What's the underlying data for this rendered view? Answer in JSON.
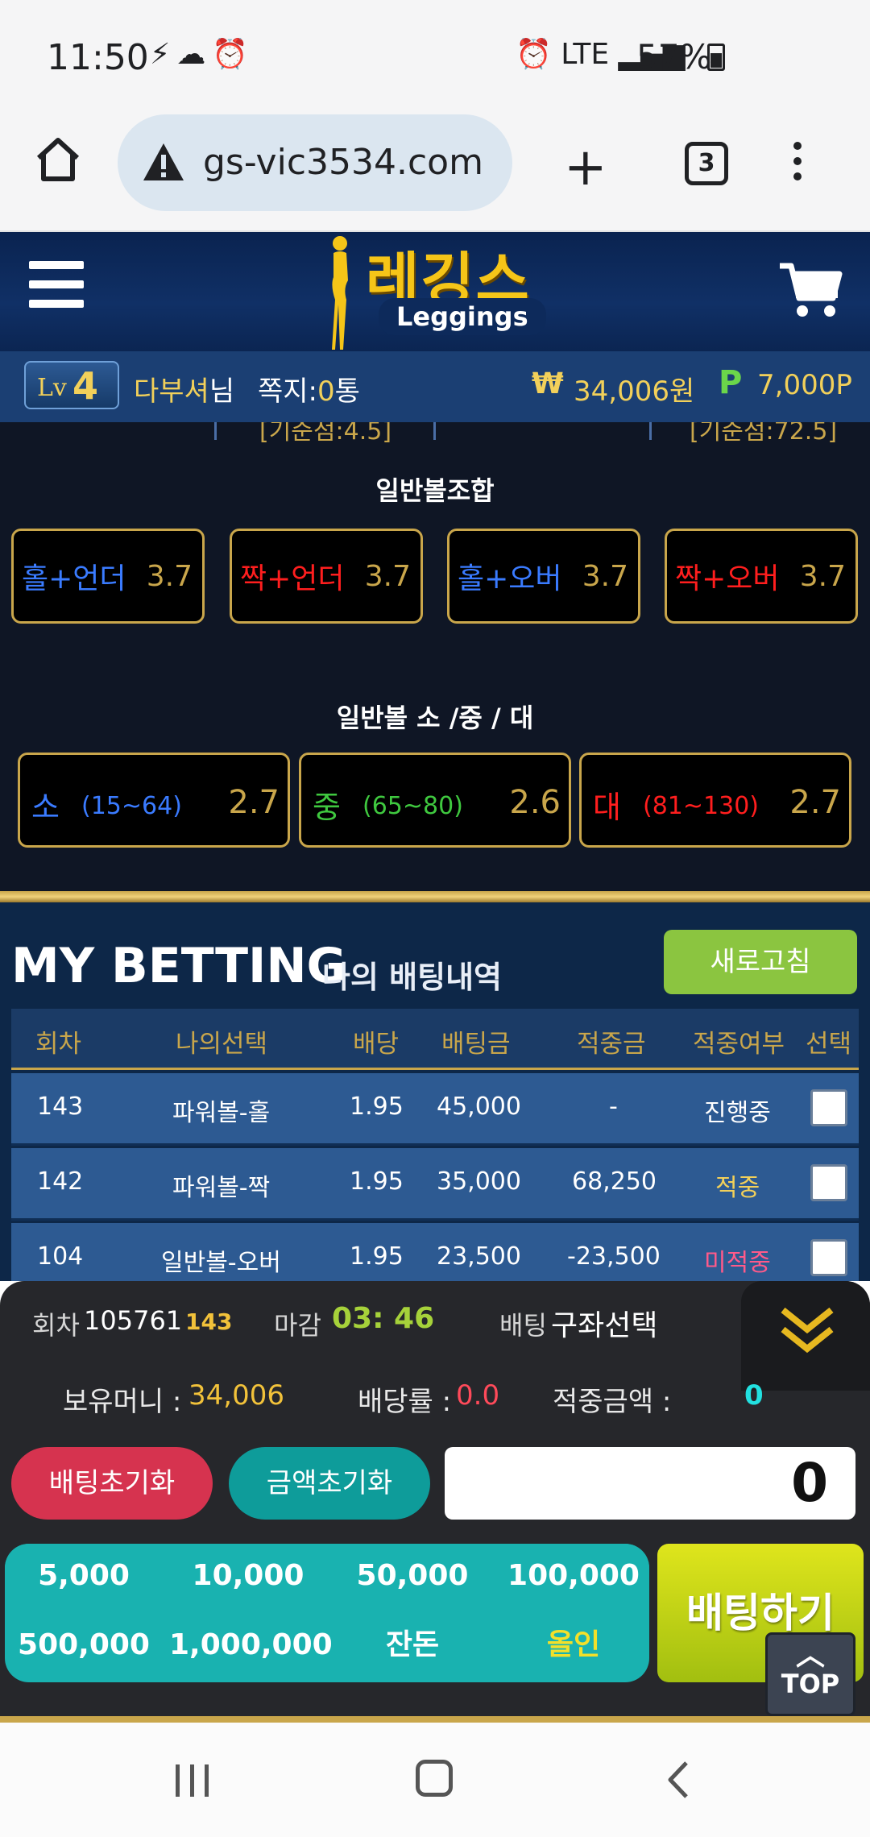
{
  "status_bar": {
    "time": "11:50",
    "left_icons": "⚡☁⏰",
    "right_icons": "⏰ LTE ▂▄▆",
    "battery": "57%"
  },
  "browser": {
    "url": "gs-vic3534.com",
    "tab_count": "3"
  },
  "header": {
    "logo_main": "레깅스",
    "logo_sub": "Leggings"
  },
  "user": {
    "lv_prefix": "Lv",
    "level": "4",
    "name": "다부셔",
    "name_suffix": "님",
    "message_label": "쪽지:",
    "message_count": "0",
    "message_unit": "통",
    "money": "34,006원",
    "points": "7,000P"
  },
  "prev_section": {
    "left": "[기준점:4.5]",
    "right": "[기준점:72.5]"
  },
  "combo_section": {
    "title": "일반볼조합",
    "options": [
      {
        "label": "홀+언더",
        "odds": "3.7",
        "color": "#3a7bff"
      },
      {
        "label": "짝+언더",
        "odds": "3.7",
        "color": "#ff1e1e"
      },
      {
        "label": "홀+오버",
        "odds": "3.7",
        "color": "#3a7bff"
      },
      {
        "label": "짝+오버",
        "odds": "3.7",
        "color": "#ff1e1e"
      }
    ]
  },
  "size_section": {
    "title": "일반볼 소 /중 / 대",
    "options": [
      {
        "label": "소",
        "range": "(15~64)",
        "odds": "2.7",
        "color": "#3a7bff"
      },
      {
        "label": "중",
        "range": "(65~80)",
        "odds": "2.6",
        "color": "#3fc83f"
      },
      {
        "label": "대",
        "range": "(81~130)",
        "odds": "2.7",
        "color": "#ff1e1e"
      }
    ]
  },
  "my_betting": {
    "title": "MY BETTING",
    "subtitle": "나의 배팅내역",
    "refresh_label": "새로고침",
    "columns": [
      "회차",
      "나의선택",
      "배당",
      "배팅금",
      "적중금",
      "적중여부",
      "선택"
    ],
    "rows": [
      {
        "round": "143",
        "choice": "파워볼-홀",
        "odds": "1.95",
        "amount": "45,000",
        "win": "-",
        "status": "진행중",
        "status_color": "#ffffff"
      },
      {
        "round": "142",
        "choice": "파워볼-짝",
        "odds": "1.95",
        "amount": "35,000",
        "win": "68,250",
        "status": "적중",
        "status_color": "#f2d05a"
      },
      {
        "round": "104",
        "choice": "일반볼-오버",
        "odds": "1.95",
        "amount": "23,500",
        "win": "-23,500",
        "status": "미적중",
        "status_color": "#ff5a8a"
      }
    ]
  },
  "bet_panel": {
    "round_label": "회차",
    "round_value": "105761",
    "round_sub": "143",
    "deadline_label": "마감",
    "deadline_value": "03: 46",
    "bet_label": "배팅",
    "bet_choice": "구좌선택",
    "holding_label": "보유머니 :",
    "holding_value": "34,006",
    "rate_label": "배당률 :",
    "rate_value": "0.0",
    "win_label": "적중금액 :",
    "win_value": "0",
    "reset_bet": "배팅초기화",
    "reset_amount": "금액초기화",
    "amount": "0",
    "chips": [
      "5,000",
      "10,000",
      "50,000",
      "100,000",
      "500,000",
      "1,000,000",
      "잔돈",
      "올인"
    ],
    "bet_button": "배팅하기",
    "top_button": "TOP"
  }
}
